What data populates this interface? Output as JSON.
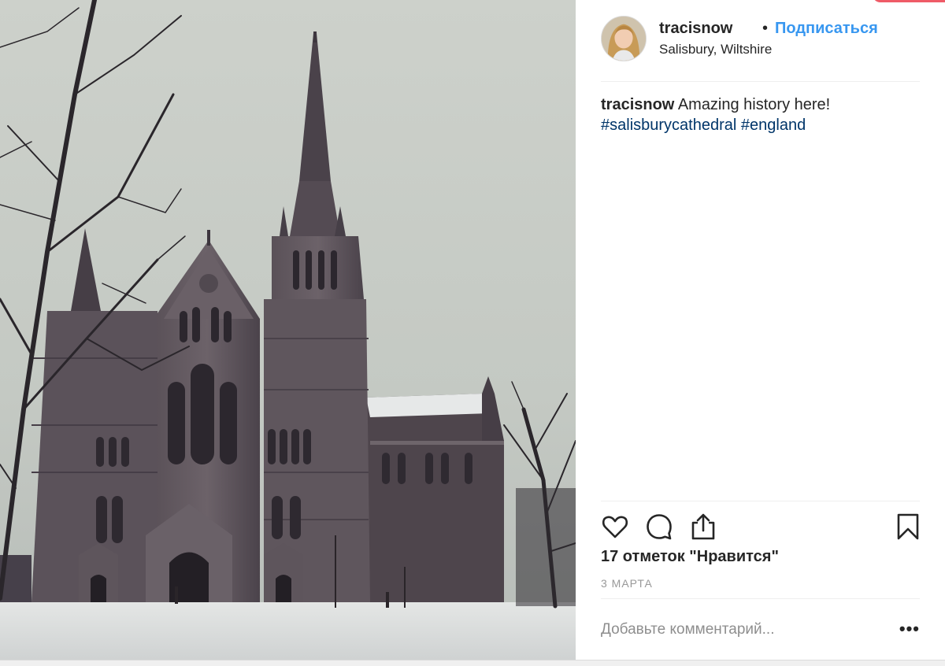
{
  "post": {
    "username": "tracisnow",
    "separator": "•",
    "follow_label": "Подписаться",
    "location": "Salisbury, Wiltshire",
    "caption_user": "tracisnow",
    "caption_text": "Amazing history here!",
    "hashtags": [
      "#salisburycathedral",
      "#england"
    ],
    "likes_text": "17 отметок \"Нравится\"",
    "date_text": "3 МАРТА",
    "comment_placeholder": "Добавьте комментарий...",
    "more_label": "•••"
  },
  "icons": {
    "like": "heart-icon",
    "comment": "comment-bubble-icon",
    "share": "share-icon",
    "save": "bookmark-icon",
    "options": "more-options-icon"
  },
  "colors": {
    "accent": "#3897f0",
    "hashtag": "#003569",
    "text": "#262626",
    "muted": "#999999"
  }
}
